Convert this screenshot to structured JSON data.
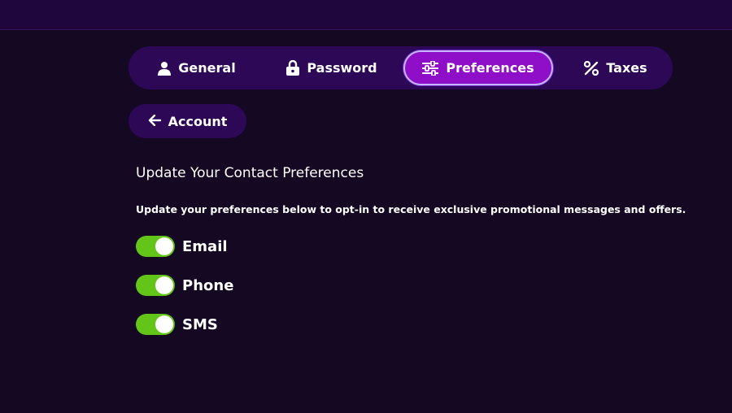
{
  "tabs": [
    {
      "label": "General",
      "icon": "user-icon",
      "active": false
    },
    {
      "label": "Password",
      "icon": "lock-icon",
      "active": false
    },
    {
      "label": "Preferences",
      "icon": "sliders-icon",
      "active": true
    },
    {
      "label": "Taxes",
      "icon": "percent-icon",
      "active": false
    }
  ],
  "back_button": {
    "label": "Account",
    "icon": "arrow-left-icon"
  },
  "section": {
    "title": "Update Your Contact Preferences",
    "description": "Update your preferences below to opt-in to receive exclusive promotional messages and offers."
  },
  "preferences": [
    {
      "label": "Email",
      "enabled": true
    },
    {
      "label": "Phone",
      "enabled": true
    },
    {
      "label": "SMS",
      "enabled": true
    }
  ],
  "colors": {
    "background": "#140822",
    "top_bar": "#1f063d",
    "pill": "#2c0857",
    "active_tab": "#8f0fc8",
    "toggle_on": "#63c518"
  }
}
